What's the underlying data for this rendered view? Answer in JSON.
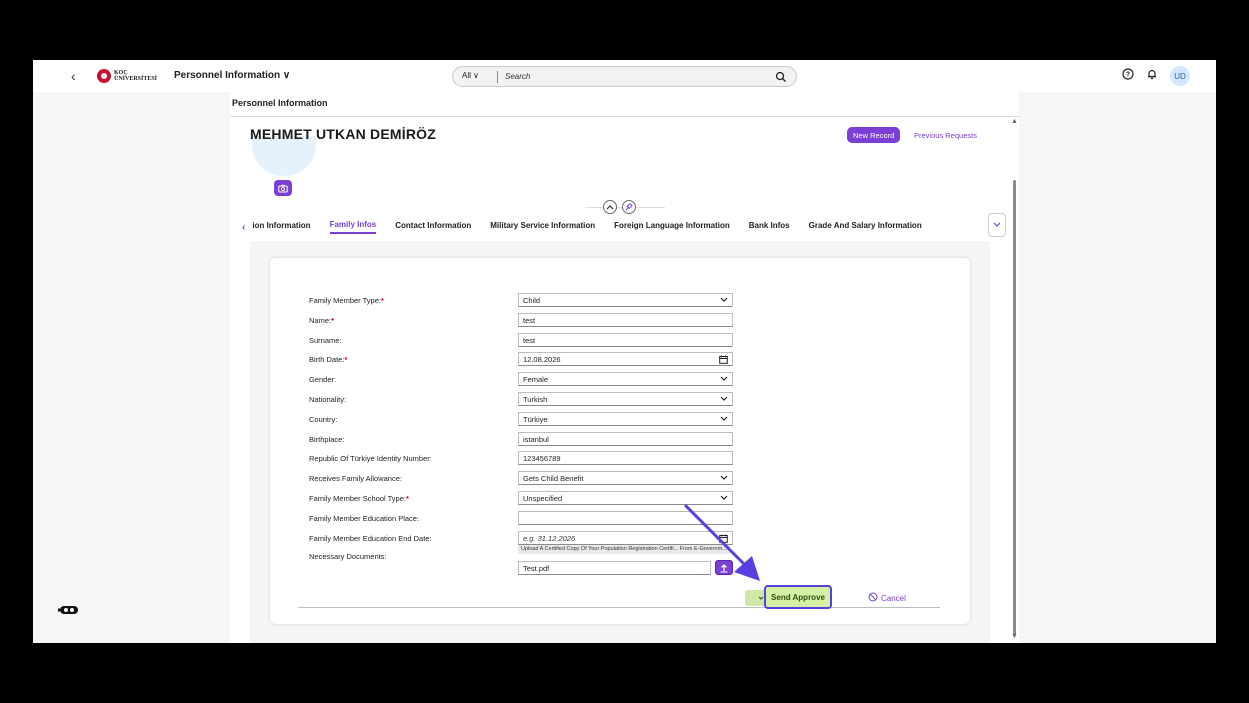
{
  "shellbar": {
    "app_title": "Personnel Information ∨",
    "logo_text_1": "KOÇ",
    "logo_text_2": "ÜNİVERSİTESİ",
    "search_scope": "All  ∨",
    "search_placeholder": "Search",
    "user_initials": "UD"
  },
  "page": {
    "title": "Personnel Information",
    "employee_name": "MEHMET UTKAN DEMİRÖZ",
    "new_record": "New Record",
    "previous_requests": "Previous Requests"
  },
  "tabs": [
    {
      "label": "ion Information"
    },
    {
      "label": "Family Infos",
      "active": true
    },
    {
      "label": "Contact Information"
    },
    {
      "label": "Military Service Information"
    },
    {
      "label": "Foreign Language Information"
    },
    {
      "label": "Bank Infos"
    },
    {
      "label": "Grade And Salary Information"
    }
  ],
  "form": {
    "rows": [
      {
        "label": "Family Member Type:",
        "required": true,
        "value": "Child",
        "type": "select"
      },
      {
        "label": "Name:",
        "required": true,
        "value": "test",
        "type": "text"
      },
      {
        "label": "Surname:",
        "required": false,
        "value": "test",
        "type": "text"
      },
      {
        "label": "Birth Date:",
        "required": true,
        "value": "12.08.2026",
        "type": "date"
      },
      {
        "label": "Gender:",
        "required": false,
        "value": "Female",
        "type": "select"
      },
      {
        "label": "Nationality:",
        "required": false,
        "value": "Turkish",
        "type": "select"
      },
      {
        "label": "Country:",
        "required": false,
        "value": "Türkiye",
        "type": "select"
      },
      {
        "label": "Birthplace:",
        "required": false,
        "value": "istanbul",
        "type": "text"
      },
      {
        "label": "Republic Of Türkiye Identity Number:",
        "required": false,
        "value": "123456789",
        "type": "text"
      },
      {
        "label": "Receives Family Allowance:",
        "required": false,
        "value": "Gets Child Benefit",
        "type": "select"
      },
      {
        "label": "Family Member School Type:",
        "required": true,
        "value": "Unspecified",
        "type": "select"
      },
      {
        "label": "Family Member Education Place:",
        "required": false,
        "value": "",
        "type": "text"
      },
      {
        "label": "Family Member Education End Date:",
        "required": false,
        "value": "e.g. 31.12.2026",
        "type": "date-placeholder"
      }
    ],
    "documents_label": "Necessary Documents:",
    "upload_hint": "Upload A Certified Copy Of Your Population Registration Certifi... From E-Governm...",
    "file_name": "Test.pdf"
  },
  "actions": {
    "send_approve": "Send Approve",
    "cancel": "Cancel"
  },
  "colors": {
    "accent": "#7b3fd6",
    "send_bg": "#d6f0a6",
    "highlight": "#5a3fe0"
  }
}
